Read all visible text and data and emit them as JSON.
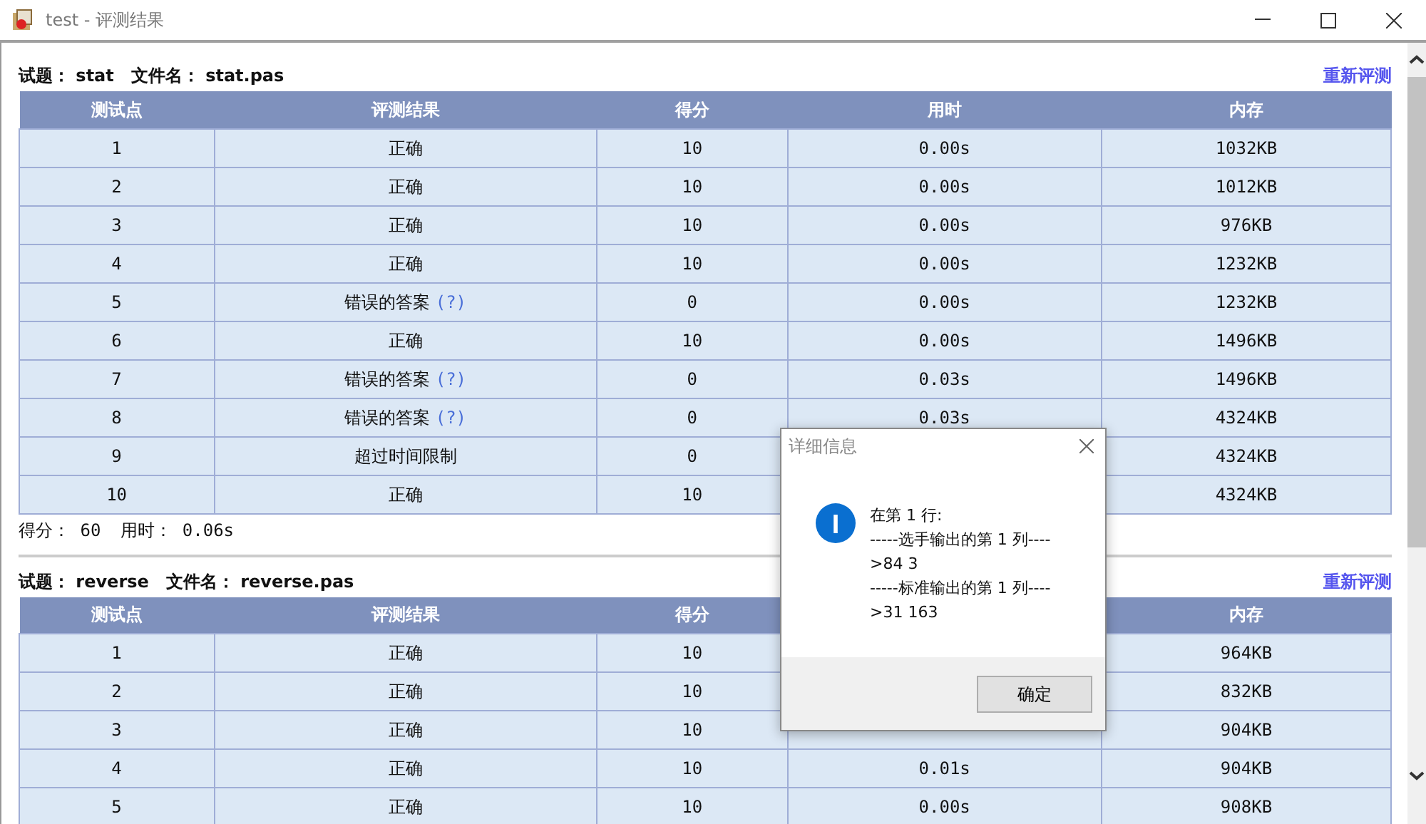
{
  "window": {
    "title": "test - 评测结果"
  },
  "problems": [
    {
      "problem": "试题： stat",
      "file": "文件名： stat.pas",
      "rejudge": "重新评测",
      "columns": [
        "测试点",
        "评测结果",
        "得分",
        "用时",
        "内存"
      ],
      "rows": [
        {
          "id": "1",
          "result": "正确",
          "score": "10",
          "time": "0.00s",
          "memory": "1032KB"
        },
        {
          "id": "2",
          "result": "正确",
          "score": "10",
          "time": "0.00s",
          "memory": "1012KB"
        },
        {
          "id": "3",
          "result": "正确",
          "score": "10",
          "time": "0.00s",
          "memory": "976KB"
        },
        {
          "id": "4",
          "result": "正确",
          "score": "10",
          "time": "0.00s",
          "memory": "1232KB"
        },
        {
          "id": "5",
          "result": "错误的答案",
          "help": "(?)",
          "score": "0",
          "time": "0.00s",
          "memory": "1232KB"
        },
        {
          "id": "6",
          "result": "正确",
          "score": "10",
          "time": "0.00s",
          "memory": "1496KB"
        },
        {
          "id": "7",
          "result": "错误的答案",
          "help": "(?)",
          "score": "0",
          "time": "0.03s",
          "memory": "1496KB"
        },
        {
          "id": "8",
          "result": "错误的答案",
          "help": "(?)",
          "score": "0",
          "time": "0.03s",
          "memory": "4324KB"
        },
        {
          "id": "9",
          "result": "超过时间限制",
          "score": "0",
          "memory": "4324KB"
        },
        {
          "id": "10",
          "result": "正确",
          "score": "10",
          "memory": "4324KB"
        }
      ],
      "summary": [
        "得分： 60",
        "用时： 0.06s"
      ]
    },
    {
      "problem": "试题： reverse",
      "file": "文件名： reverse.pas",
      "rejudge": "重新评测",
      "columns": [
        "测试点",
        "评测结果",
        "得分",
        null,
        "内存"
      ],
      "rows": [
        {
          "id": "1",
          "result": "正确",
          "score": "10",
          "memory": "964KB"
        },
        {
          "id": "2",
          "result": "正确",
          "score": "10",
          "memory": "832KB"
        },
        {
          "id": "3",
          "result": "正确",
          "score": "10",
          "memory": "904KB"
        },
        {
          "id": "4",
          "result": "正确",
          "score": "10",
          "time": "0.01s",
          "memory": "904KB"
        },
        {
          "id": "5",
          "result": "正确",
          "score": "10",
          "time": "0.00s",
          "memory": "908KB"
        }
      ]
    }
  ],
  "dialog": {
    "title": "详细信息",
    "message": [
      "在第 1 行:",
      "-----选手输出的第 1 列----",
      ">84 3",
      "-----标准输出的第 1 列----",
      ">31 163"
    ],
    "button": "确定"
  }
}
